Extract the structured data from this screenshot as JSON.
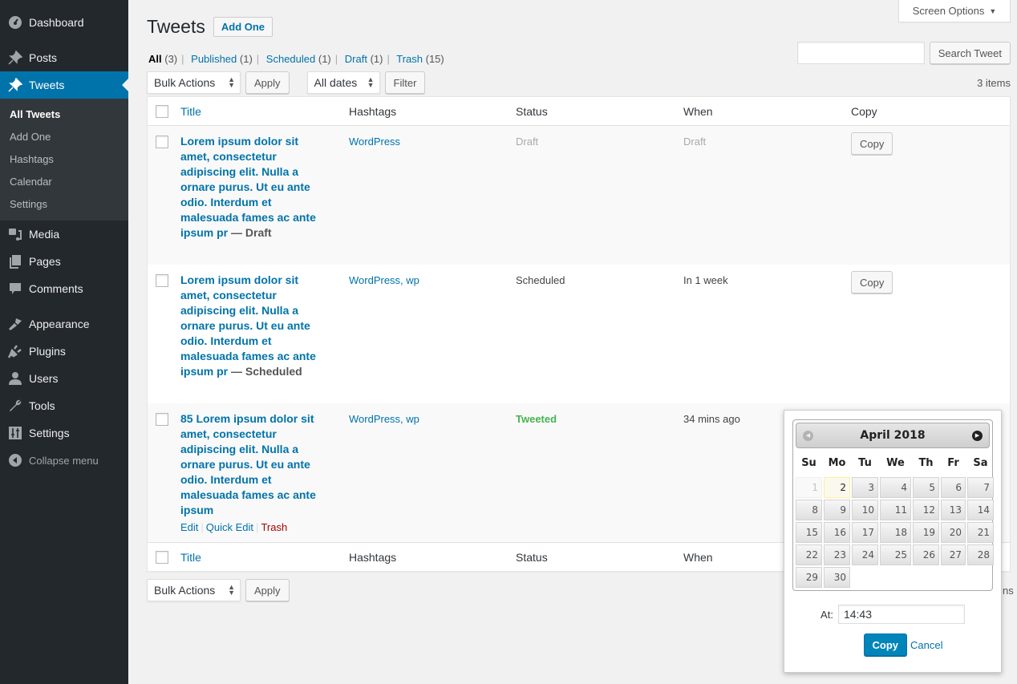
{
  "sidebar": {
    "items": [
      {
        "label": "Dashboard",
        "icon": "dashboard-icon"
      },
      {
        "label": "Posts",
        "icon": "pin-icon"
      },
      {
        "label": "Tweets",
        "icon": "pin-icon",
        "active": true
      },
      {
        "label": "Media",
        "icon": "media-icon"
      },
      {
        "label": "Pages",
        "icon": "pages-icon"
      },
      {
        "label": "Comments",
        "icon": "comment-icon"
      },
      {
        "label": "Appearance",
        "icon": "brush-icon"
      },
      {
        "label": "Plugins",
        "icon": "plug-icon"
      },
      {
        "label": "Users",
        "icon": "user-icon"
      },
      {
        "label": "Tools",
        "icon": "wrench-icon"
      },
      {
        "label": "Settings",
        "icon": "sliders-icon"
      }
    ],
    "submenu": [
      "All Tweets",
      "Add One",
      "Hashtags",
      "Calendar",
      "Settings"
    ],
    "collapse_label": "Collapse menu"
  },
  "header": {
    "screen_options": "Screen Options",
    "title": "Tweets",
    "add_button": "Add One"
  },
  "filters": {
    "views": [
      {
        "label": "All",
        "count": "(3)"
      },
      {
        "label": "Published",
        "count": "(1)"
      },
      {
        "label": "Scheduled",
        "count": "(1)"
      },
      {
        "label": "Draft",
        "count": "(1)"
      },
      {
        "label": "Trash",
        "count": "(15)"
      }
    ],
    "bulk_actions": "Bulk Actions",
    "apply": "Apply",
    "dates": "All dates",
    "filter": "Filter",
    "search_placeholder": "",
    "search_button": "Search Tweet",
    "items_count": "3 items"
  },
  "table": {
    "columns": [
      "Title",
      "Hashtags",
      "Status",
      "When",
      "Copy"
    ],
    "footer_columns": [
      "Title",
      "Hashtags",
      "Status",
      "When"
    ],
    "rows": [
      {
        "title": "Lorem ipsum dolor sit amet, consectetur adipiscing elit. Nulla a ornare purus. Ut eu ante odio. Interdum et malesuada fames ac ante ipsum pr",
        "state": " — Draft",
        "hashtags": "WordPress",
        "status": "Draft",
        "when": "Draft",
        "copy": "Copy"
      },
      {
        "title": "Lorem ipsum dolor sit amet, consectetur adipiscing elit. Nulla a ornare purus. Ut eu ante odio. Interdum et malesuada fames ac ante ipsum pr",
        "state": " — Scheduled",
        "hashtags": "WordPress, wp",
        "status": "Scheduled",
        "when": "In 1 week",
        "copy": "Copy"
      },
      {
        "title": "85 Lorem ipsum dolor sit amet, consectetur adipiscing elit. Nulla a ornare purus. Ut eu ante odio. Interdum et malesuada fames ac ante ipsum",
        "state": "",
        "hashtags": "WordPress, wp",
        "status": "Tweeted",
        "when": "34 mins ago",
        "actions": [
          "Edit",
          "Quick Edit",
          "Trash"
        ]
      }
    ]
  },
  "copy_popup": {
    "month_label": "April 2018",
    "weekdays": [
      "Su",
      "Mo",
      "Tu",
      "We",
      "Th",
      "Fr",
      "Sa"
    ],
    "days": [
      "1",
      "2",
      "3",
      "4",
      "5",
      "6",
      "7",
      "8",
      "9",
      "10",
      "11",
      "12",
      "13",
      "14",
      "15",
      "16",
      "17",
      "18",
      "19",
      "20",
      "21",
      "22",
      "23",
      "24",
      "25",
      "26",
      "27",
      "28",
      "29",
      "30"
    ],
    "disabled_day": "1",
    "today": "2",
    "at_label": "At:",
    "time_value": "14:43",
    "copy_button": "Copy",
    "cancel_link": "Cancel",
    "clipped_text": "ns"
  },
  "colors": {
    "accent": "#0073aa",
    "sidebar_bg": "#23282d",
    "tweeted": "#46b450",
    "trash": "#a00000"
  }
}
